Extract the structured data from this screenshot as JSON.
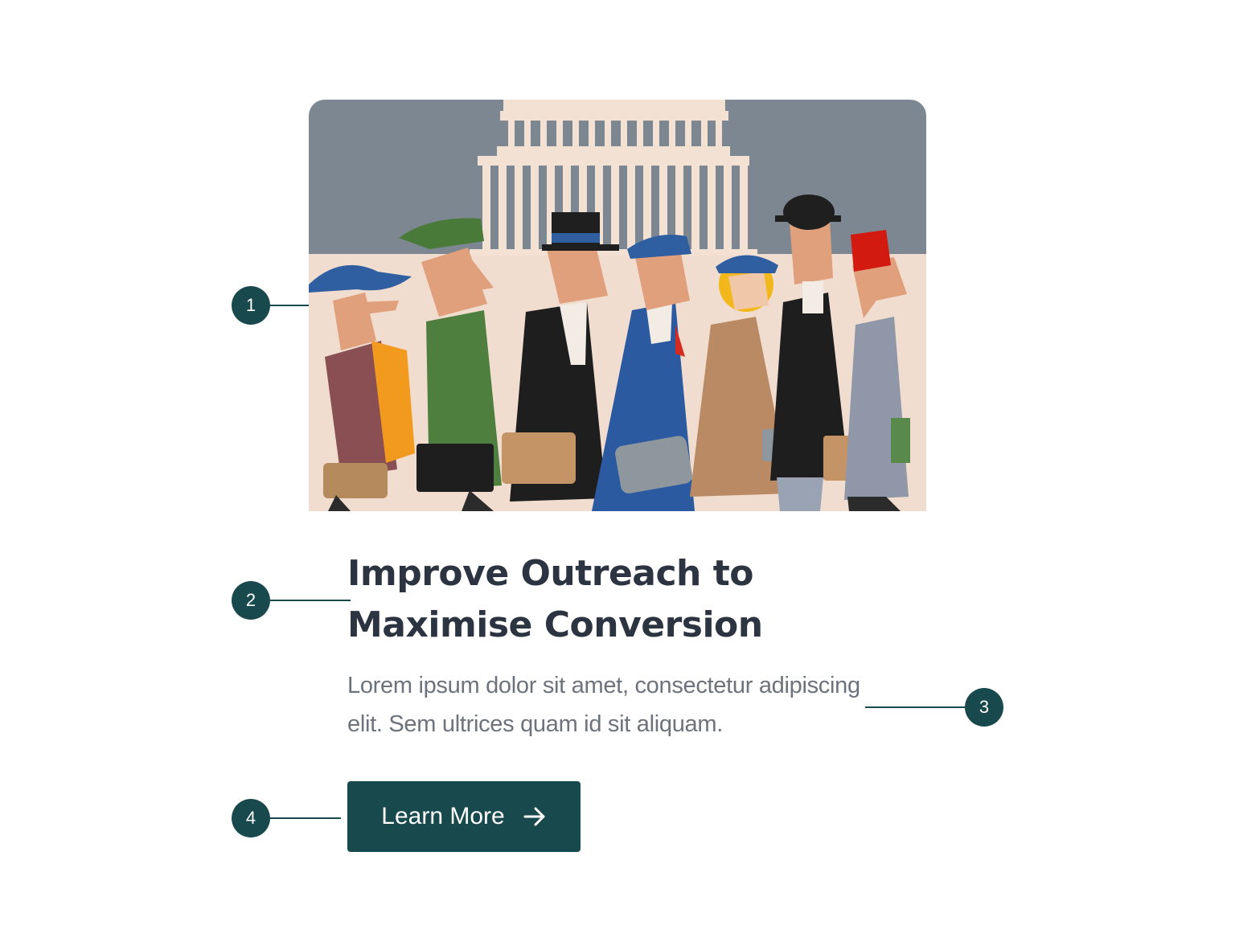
{
  "card": {
    "image_alt": "Vintage-style illustration of a crowd of people in hats carrying briefcases in front of a columned government building",
    "title": "Improve Outreach to Maximise Conversion",
    "description": "Lorem ipsum dolor sit amet, consectetur adipiscing elit. Sem ultrices quam id sit aliquam.",
    "button_label": "Learn More",
    "button_icon": "arrow-right-icon"
  },
  "annotations": [
    {
      "number": "1",
      "target": "image"
    },
    {
      "number": "2",
      "target": "title"
    },
    {
      "number": "3",
      "target": "description"
    },
    {
      "number": "4",
      "target": "button"
    }
  ],
  "colors": {
    "accent": "#17494d",
    "title": "#2b3440",
    "body": "#6c737c",
    "background": "#ffffff"
  }
}
